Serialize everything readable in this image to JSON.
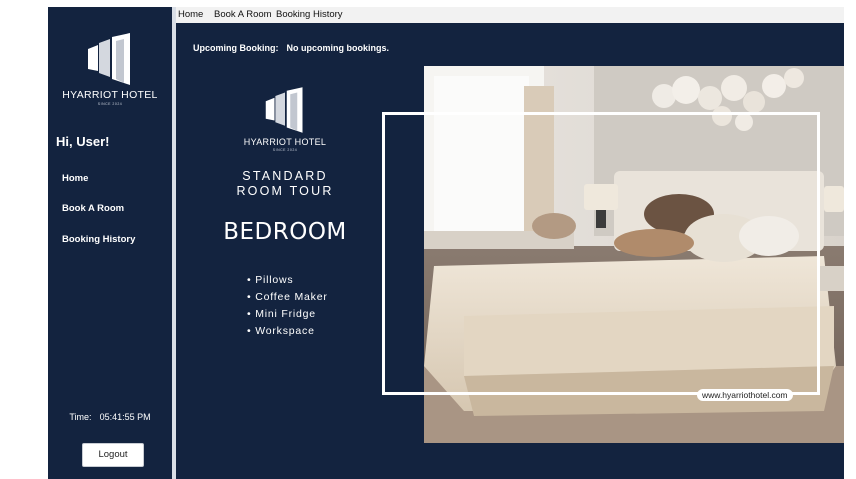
{
  "sidebar": {
    "logo_name": "HYARRIOT HOTEL",
    "logo_since": "SINCE 2024",
    "greeting": "Hi, User!",
    "items": [
      {
        "label": "Home"
      },
      {
        "label": "Book A Room"
      },
      {
        "label": "Booking History"
      }
    ],
    "time_label": "Time:",
    "time_value": "05:41:55 PM",
    "logout_label": "Logout"
  },
  "tabs": [
    {
      "label": "Home"
    },
    {
      "label": "Book A Room"
    },
    {
      "label": "Booking History"
    }
  ],
  "main": {
    "upcoming_label": "Upcoming Booking:",
    "upcoming_value": "No upcoming bookings."
  },
  "hero": {
    "logo_name": "HYARRIOT HOTEL",
    "logo_since": "SINCE 2024",
    "tour_line1": "STANDARD",
    "tour_line2": "ROOM TOUR",
    "room_name": "BEDROOM",
    "amenities": [
      "Pillows",
      "Coffee Maker",
      "Mini Fridge",
      "Workspace"
    ],
    "website": "www.hyarriothotel.com"
  },
  "colors": {
    "navy": "#13233f",
    "white": "#ffffff",
    "tabbar": "#f2f2f2"
  }
}
